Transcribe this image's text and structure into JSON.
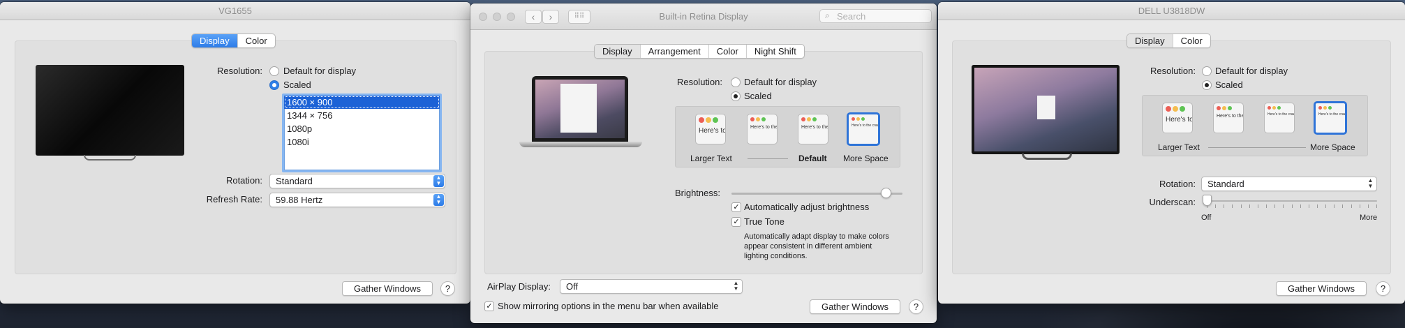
{
  "win_vg": {
    "title": "VG1655",
    "tabs": [
      {
        "label": "Display"
      },
      {
        "label": "Color"
      }
    ],
    "resolution_label": "Resolution:",
    "res_default": "Default for display",
    "res_scaled": "Scaled",
    "res_options": [
      "1600 × 900",
      "1344 × 756",
      "1080p",
      "1080i"
    ],
    "rotation_label": "Rotation:",
    "rotation_value": "Standard",
    "refresh_label": "Refresh Rate:",
    "refresh_value": "59.88 Hertz",
    "gather_label": "Gather Windows",
    "help_label": "?"
  },
  "win_retina": {
    "title": "Built-in Retina Display",
    "search_placeholder": "Search",
    "tabs": [
      {
        "label": "Display"
      },
      {
        "label": "Arrangement"
      },
      {
        "label": "Color"
      },
      {
        "label": "Night Shift"
      }
    ],
    "resolution_label": "Resolution:",
    "res_default": "Default for display",
    "res_scaled": "Scaled",
    "thumb_text": "Here's to the crazy ones. The misfits. The troublemakers. The round pegs",
    "scale_larger": "Larger Text",
    "scale_default": "Default",
    "scale_more": "More Space",
    "brightness_label": "Brightness:",
    "brightness_level": 0.9,
    "auto_brightness_label": "Automatically adjust brightness",
    "true_tone_label": "True Tone",
    "true_tone_desc": [
      "Automatically adapt display to make colors",
      "appear consistent in different ambient",
      "lighting conditions."
    ],
    "airplay_label": "AirPlay Display:",
    "airplay_value": "Off",
    "mirroring_label": "Show mirroring options in the menu bar when available",
    "gather_label": "Gather Windows",
    "help_label": "?"
  },
  "win_dell": {
    "title": "DELL U3818DW",
    "tabs": [
      {
        "label": "Display"
      },
      {
        "label": "Color"
      }
    ],
    "resolution_label": "Resolution:",
    "res_default": "Default for display",
    "res_scaled": "Scaled",
    "scale_larger": "Larger Text",
    "scale_more": "More Space",
    "rotation_label": "Rotation:",
    "rotation_value": "Standard",
    "underscan_label": "Underscan:",
    "underscan_off": "Off",
    "underscan_more": "More",
    "gather_label": "Gather Windows",
    "help_label": "?"
  },
  "colors": {
    "accent": "#2d7ce8",
    "red": "#ec5f56",
    "yellow": "#f5bd4f",
    "green": "#5fc454"
  }
}
